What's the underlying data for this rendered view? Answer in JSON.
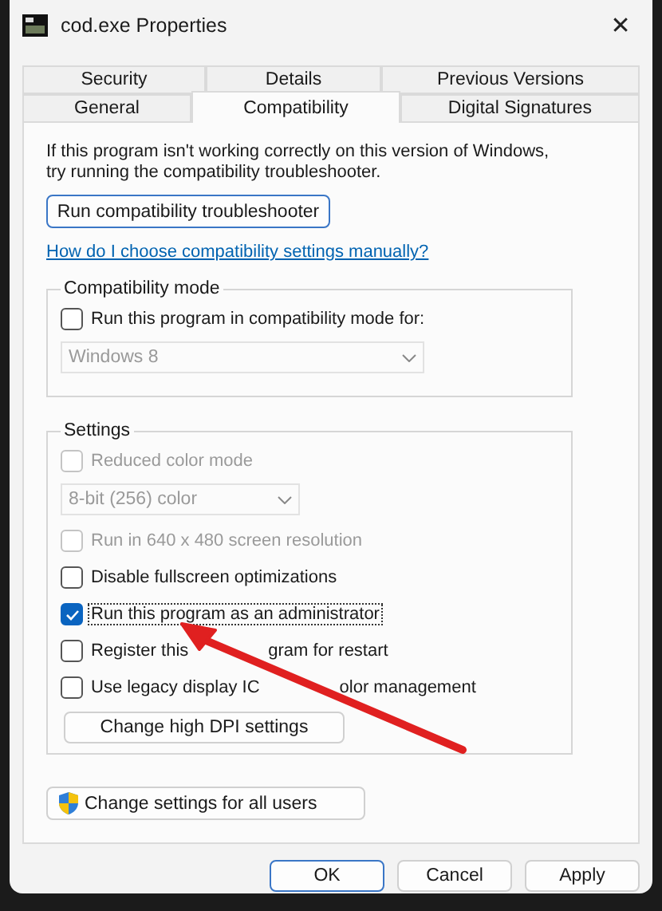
{
  "window": {
    "title": "cod.exe Properties",
    "close": "✕"
  },
  "tab_rows": [
    [
      {
        "label": "Security",
        "selected": false
      },
      {
        "label": "Details",
        "selected": false
      },
      {
        "label": "Previous Versions",
        "selected": false
      }
    ],
    [
      {
        "label": "General",
        "selected": false
      },
      {
        "label": "Compatibility",
        "selected": true
      },
      {
        "label": "Digital Signatures",
        "selected": false
      }
    ]
  ],
  "intro": "If this program isn't working correctly on this version of Windows, try running the compatibility troubleshooter.",
  "troubleshooter_button": "Run compatibility troubleshooter",
  "help_link": "How do I choose compatibility settings manually?",
  "compatibility_mode": {
    "title": "Compatibility mode",
    "items": [
      {
        "kind": "checkbox",
        "label": [
          "Run this program in compatibility mode for:"
        ],
        "checked": false,
        "disabled": false
      },
      {
        "kind": "dropdown",
        "value": "Windows 8",
        "disabled": true
      }
    ]
  },
  "settings": {
    "title": "Settings",
    "items": [
      {
        "kind": "checkbox",
        "label": [
          "Reduced color mode"
        ],
        "checked": false,
        "disabled": true
      },
      {
        "kind": "dropdown",
        "value": "8-bit (256) color",
        "disabled": true
      },
      {
        "kind": "checkbox",
        "label": [
          "Run in 640 x 480 screen resolution"
        ],
        "checked": false,
        "disabled": true
      },
      {
        "kind": "checkbox",
        "label": [
          "Disable fullscreen optimizations"
        ],
        "checked": false,
        "disabled": false
      },
      {
        "kind": "checkbox",
        "label": [
          "Run this program as an administrator"
        ],
        "checked": true,
        "disabled": false
      },
      {
        "kind": "checkbox",
        "label": [
          "Register this",
          "gram for restart"
        ],
        "checked": false,
        "disabled": false
      },
      {
        "kind": "checkbox",
        "label": [
          "Use legacy display IC",
          "olor management"
        ],
        "checked": false,
        "disabled": false
      },
      {
        "kind": "button",
        "label": "Change high DPI settings"
      }
    ]
  },
  "all_users_button": "Change settings for all users",
  "buttons": [
    {
      "label": "OK",
      "primary": true
    },
    {
      "label": "Cancel",
      "primary": false
    },
    {
      "label": "Apply",
      "primary": false
    }
  ]
}
